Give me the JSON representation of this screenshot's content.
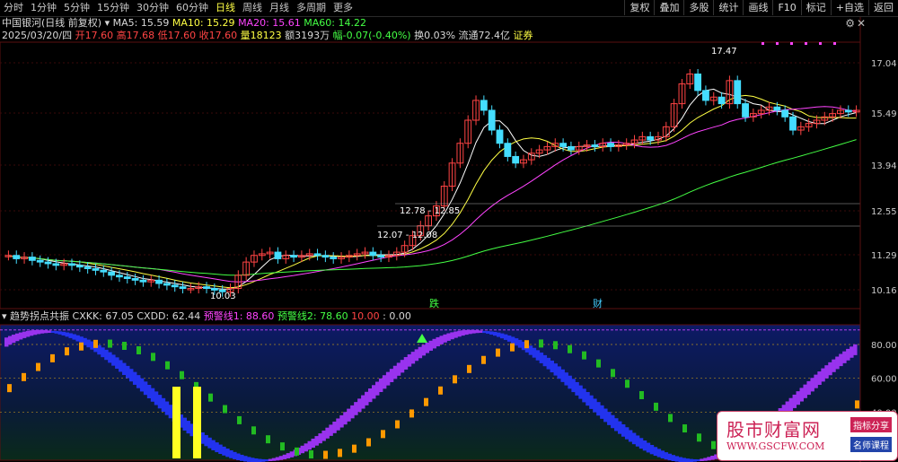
{
  "periods": [
    "分时",
    "1分钟",
    "5分钟",
    "15分钟",
    "30分钟",
    "60分钟",
    "日线",
    "周线",
    "月线",
    "多周期",
    "更多"
  ],
  "period_active": "日线",
  "toolbar_right": [
    "复权",
    "叠加",
    "多股",
    "统计",
    "画线",
    "F10",
    "标记",
    "+自选",
    "返回"
  ],
  "info1": {
    "stock": "中国银河(日线 前复权)",
    "ma5": "MA5: 15.59",
    "ma10": "MA10: 15.29",
    "ma20": "MA20: 15.61",
    "ma60": "MA60: 14.22"
  },
  "info2": {
    "date": "2025/03/20/四",
    "open": "开17.60",
    "high": "高17.68",
    "low": "低17.60",
    "close": "收17.60",
    "vol": "量18123",
    "amt": "额3193万",
    "chg": "幅-0.07(-0.40%)",
    "turn": "换0.03%",
    "float": "流通72.4亿",
    "tag": "证券"
  },
  "price_axis": [
    "17.04",
    "15.49",
    "13.94",
    "12.55",
    "11.29",
    "10.16"
  ],
  "indicator_axis": [
    "80.00",
    "60.00",
    "40.00"
  ],
  "annotations": {
    "high_label": "17.47",
    "low_label": "10.03",
    "zone1": "12.78 - 12.85",
    "zone2": "12.07 - 12.08",
    "event1": "跌",
    "event2": "财"
  },
  "indicator": {
    "name": "趋势拐点共振",
    "cxkk": "CXKK: 67.05",
    "cxdd": "CXDD: 62.44",
    "warn1": "预警线1: 88.60",
    "warn2": "预警线2: 78.60",
    "v1": "10.00",
    "v2": ": 0.00"
  },
  "watermark": {
    "title": "股市财富网",
    "url": "WWW.GSCFW.COM",
    "tag1": "指标分享",
    "tag2": "名师课程"
  },
  "colors": {
    "up": "#ff4444",
    "down": "#44ddff",
    "ma5": "#ffffff",
    "ma10": "#ffff44",
    "ma20": "#ff44ff",
    "ma60": "#44ff44"
  }
}
